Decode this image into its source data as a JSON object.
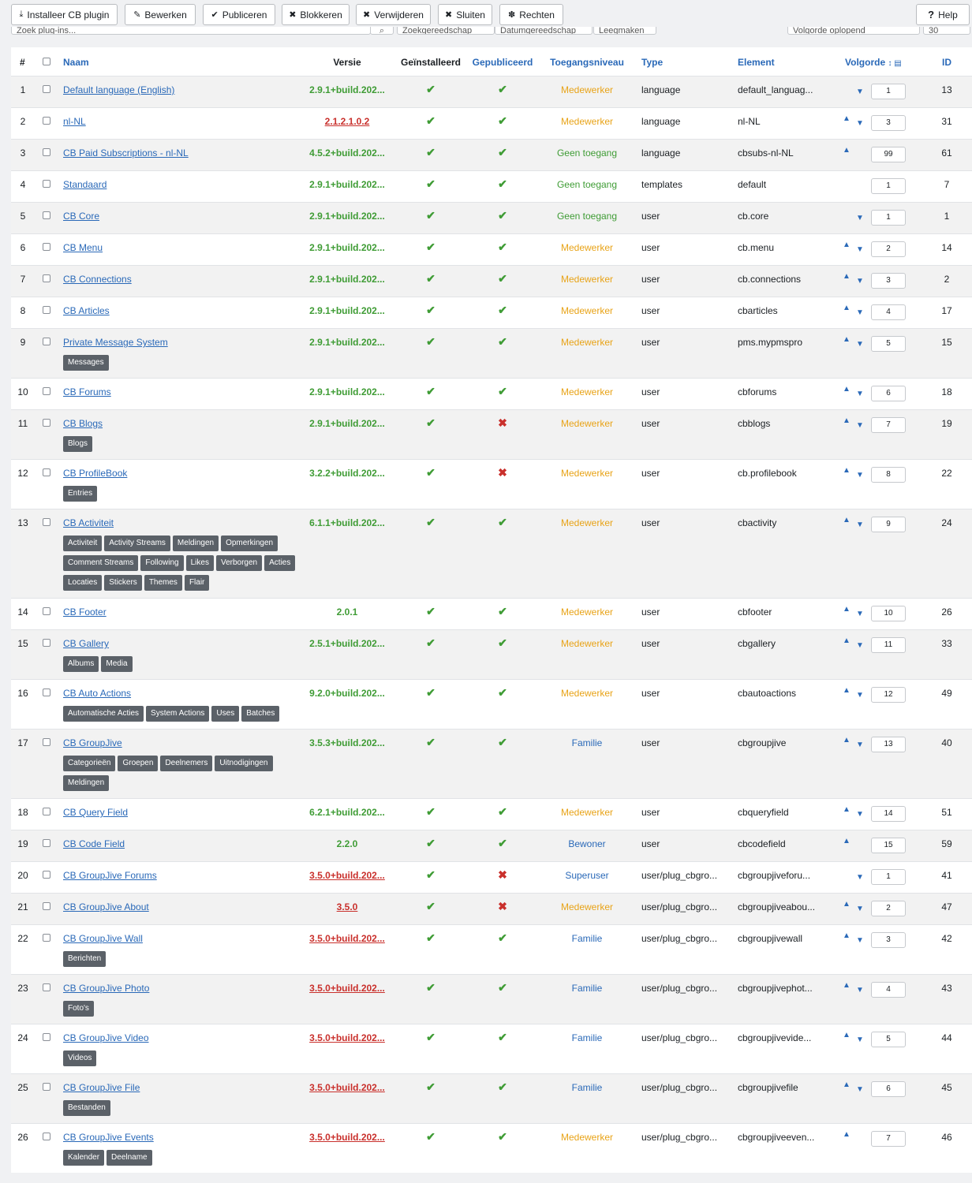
{
  "toolbar": {
    "install": "Installeer CB plugin",
    "edit": "Bewerken",
    "publish": "Publiceren",
    "block": "Blokkeren",
    "delete": "Verwijderen",
    "close": "Sluiten",
    "rights": "Rechten",
    "help": "Help"
  },
  "filters": {
    "search_placeholder": "Zoek plug-ins...",
    "filter1": "Zoekgereedschap",
    "filter2": "Datumgereedschap",
    "filter3": "Leegmaken",
    "sort": "Volgorde oplopend",
    "limit": "30"
  },
  "table": {
    "headers": {
      "num": "#",
      "name": "Naam",
      "version": "Versie",
      "installed": "Geïnstalleerd",
      "published": "Gepubliceerd",
      "access": "Toegangsniveau",
      "type": "Type",
      "element": "Element",
      "order": "Volgorde",
      "id": "ID"
    },
    "rows": [
      {
        "num": "1",
        "name": "Default language (English)",
        "version": "2.9.1+build.202...",
        "ver_ok": true,
        "published": true,
        "access": "Medewerker",
        "type": "language",
        "element": "default_languag...",
        "order": "1",
        "id": "13",
        "up": false,
        "down": true,
        "tags": []
      },
      {
        "num": "2",
        "name": "nl-NL",
        "version": "2.1.2.1.0.2",
        "ver_ok": false,
        "published": true,
        "access": "Medewerker",
        "type": "language",
        "element": "nl-NL",
        "order": "3",
        "id": "31",
        "up": true,
        "down": true,
        "tags": []
      },
      {
        "num": "3",
        "name": "CB Paid Subscriptions - nl-NL",
        "version": "4.5.2+build.202...",
        "ver_ok": true,
        "published": true,
        "access": "Geen toegang",
        "type": "language",
        "element": "cbsubs-nl-NL",
        "order": "99",
        "id": "61",
        "up": true,
        "down": false,
        "tags": []
      },
      {
        "num": "4",
        "name": "Standaard",
        "version": "2.9.1+build.202...",
        "ver_ok": true,
        "published": true,
        "access": "Geen toegang",
        "type": "templates",
        "element": "default",
        "order": "1",
        "id": "7",
        "up": false,
        "down": false,
        "tags": []
      },
      {
        "num": "5",
        "name": "CB Core",
        "version": "2.9.1+build.202...",
        "ver_ok": true,
        "published": true,
        "access": "Geen toegang",
        "type": "user",
        "element": "cb.core",
        "order": "1",
        "id": "1",
        "up": false,
        "down": true,
        "tags": []
      },
      {
        "num": "6",
        "name": "CB Menu",
        "version": "2.9.1+build.202...",
        "ver_ok": true,
        "published": true,
        "access": "Medewerker",
        "type": "user",
        "element": "cb.menu",
        "order": "2",
        "id": "14",
        "up": true,
        "down": true,
        "tags": []
      },
      {
        "num": "7",
        "name": "CB Connections",
        "version": "2.9.1+build.202...",
        "ver_ok": true,
        "published": true,
        "access": "Medewerker",
        "type": "user",
        "element": "cb.connections",
        "order": "3",
        "id": "2",
        "up": true,
        "down": true,
        "tags": []
      },
      {
        "num": "8",
        "name": "CB Articles",
        "version": "2.9.1+build.202...",
        "ver_ok": true,
        "published": true,
        "access": "Medewerker",
        "type": "user",
        "element": "cbarticles",
        "order": "4",
        "id": "17",
        "up": true,
        "down": true,
        "tags": []
      },
      {
        "num": "9",
        "name": "Private Message System",
        "version": "2.9.1+build.202...",
        "ver_ok": true,
        "published": true,
        "access": "Medewerker",
        "type": "user",
        "element": "pms.mypmspro",
        "order": "5",
        "id": "15",
        "up": true,
        "down": true,
        "tags": [
          "Messages"
        ]
      },
      {
        "num": "10",
        "name": "CB Forums",
        "version": "2.9.1+build.202...",
        "ver_ok": true,
        "published": true,
        "access": "Medewerker",
        "type": "user",
        "element": "cbforums",
        "order": "6",
        "id": "18",
        "up": true,
        "down": true,
        "tags": []
      },
      {
        "num": "11",
        "name": "CB Blogs",
        "version": "2.9.1+build.202...",
        "ver_ok": true,
        "published": false,
        "access": "Medewerker",
        "type": "user",
        "element": "cbblogs",
        "order": "7",
        "id": "19",
        "up": true,
        "down": true,
        "tags": [
          "Blogs"
        ]
      },
      {
        "num": "12",
        "name": "CB ProfileBook",
        "version": "3.2.2+build.202...",
        "ver_ok": true,
        "published": false,
        "access": "Medewerker",
        "type": "user",
        "element": "cb.profilebook",
        "order": "8",
        "id": "22",
        "up": true,
        "down": true,
        "tags": [
          "Entries"
        ]
      },
      {
        "num": "13",
        "name": "CB Activiteit",
        "version": "6.1.1+build.202...",
        "ver_ok": true,
        "published": true,
        "access": "Medewerker",
        "type": "user",
        "element": "cbactivity",
        "order": "9",
        "id": "24",
        "up": true,
        "down": true,
        "tags": [
          "Activiteit",
          "Activity Streams",
          "Meldingen",
          "Opmerkingen",
          "Comment Streams",
          "Following",
          "Likes",
          "Verborgen",
          "Acties",
          "Locaties",
          "Stickers",
          "Themes",
          "Flair"
        ]
      },
      {
        "num": "14",
        "name": "CB Footer",
        "version": "2.0.1",
        "ver_ok": true,
        "published": true,
        "access": "Medewerker",
        "type": "user",
        "element": "cbfooter",
        "order": "10",
        "id": "26",
        "up": true,
        "down": true,
        "tags": []
      },
      {
        "num": "15",
        "name": "CB Gallery",
        "version": "2.5.1+build.202...",
        "ver_ok": true,
        "published": true,
        "access": "Medewerker",
        "type": "user",
        "element": "cbgallery",
        "order": "11",
        "id": "33",
        "up": true,
        "down": true,
        "tags": [
          "Albums",
          "Media"
        ]
      },
      {
        "num": "16",
        "name": "CB Auto Actions",
        "version": "9.2.0+build.202...",
        "ver_ok": true,
        "published": true,
        "access": "Medewerker",
        "type": "user",
        "element": "cbautoactions",
        "order": "12",
        "id": "49",
        "up": true,
        "down": true,
        "tags": [
          "Automatische Acties",
          "System Actions",
          "Uses",
          "Batches"
        ]
      },
      {
        "num": "17",
        "name": "CB GroupJive",
        "version": "3.5.3+build.202...",
        "ver_ok": true,
        "published": true,
        "access": "Familie",
        "type": "user",
        "element": "cbgroupjive",
        "order": "13",
        "id": "40",
        "up": true,
        "down": true,
        "tags": [
          "Categorieën",
          "Groepen",
          "Deelnemers",
          "Uitnodigingen",
          "Meldingen"
        ]
      },
      {
        "num": "18",
        "name": "CB Query Field",
        "version": "6.2.1+build.202...",
        "ver_ok": true,
        "published": true,
        "access": "Medewerker",
        "type": "user",
        "element": "cbqueryfield",
        "order": "14",
        "id": "51",
        "up": true,
        "down": true,
        "tags": []
      },
      {
        "num": "19",
        "name": "CB Code Field",
        "version": "2.2.0",
        "ver_ok": true,
        "published": true,
        "access": "Bewoner",
        "type": "user",
        "element": "cbcodefield",
        "order": "15",
        "id": "59",
        "up": true,
        "down": false,
        "tags": []
      },
      {
        "num": "20",
        "name": "CB GroupJive Forums",
        "version": "3.5.0+build.202...",
        "ver_ok": false,
        "published": false,
        "access": "Superuser",
        "type": "user/plug_cbgro...",
        "element": "cbgroupjiveforu...",
        "order": "1",
        "id": "41",
        "up": false,
        "down": true,
        "tags": []
      },
      {
        "num": "21",
        "name": "CB GroupJive About",
        "version": "3.5.0",
        "ver_ok": false,
        "published": false,
        "access": "Medewerker",
        "type": "user/plug_cbgro...",
        "element": "cbgroupjiveabou...",
        "order": "2",
        "id": "47",
        "up": true,
        "down": true,
        "tags": []
      },
      {
        "num": "22",
        "name": "CB GroupJive Wall",
        "version": "3.5.0+build.202...",
        "ver_ok": false,
        "published": true,
        "access": "Familie",
        "type": "user/plug_cbgro...",
        "element": "cbgroupjivewall",
        "order": "3",
        "id": "42",
        "up": true,
        "down": true,
        "tags": [
          "Berichten"
        ]
      },
      {
        "num": "23",
        "name": "CB GroupJive Photo",
        "version": "3.5.0+build.202...",
        "ver_ok": false,
        "published": true,
        "access": "Familie",
        "type": "user/plug_cbgro...",
        "element": "cbgroupjivephot...",
        "order": "4",
        "id": "43",
        "up": true,
        "down": true,
        "tags": [
          "Foto's"
        ]
      },
      {
        "num": "24",
        "name": "CB GroupJive Video",
        "version": "3.5.0+build.202...",
        "ver_ok": false,
        "published": true,
        "access": "Familie",
        "type": "user/plug_cbgro...",
        "element": "cbgroupjivevide...",
        "order": "5",
        "id": "44",
        "up": true,
        "down": true,
        "tags": [
          "Videos"
        ]
      },
      {
        "num": "25",
        "name": "CB GroupJive File",
        "version": "3.5.0+build.202...",
        "ver_ok": false,
        "published": true,
        "access": "Familie",
        "type": "user/plug_cbgro...",
        "element": "cbgroupjivefile",
        "order": "6",
        "id": "45",
        "up": true,
        "down": true,
        "tags": [
          "Bestanden"
        ]
      },
      {
        "num": "26",
        "name": "CB GroupJive Events",
        "version": "3.5.0+build.202...",
        "ver_ok": false,
        "published": true,
        "access": "Medewerker",
        "type": "user/plug_cbgro...",
        "element": "cbgroupjiveeven...",
        "order": "7",
        "id": "46",
        "up": true,
        "down": false,
        "tags": [
          "Kalender",
          "Deelname"
        ]
      }
    ]
  }
}
